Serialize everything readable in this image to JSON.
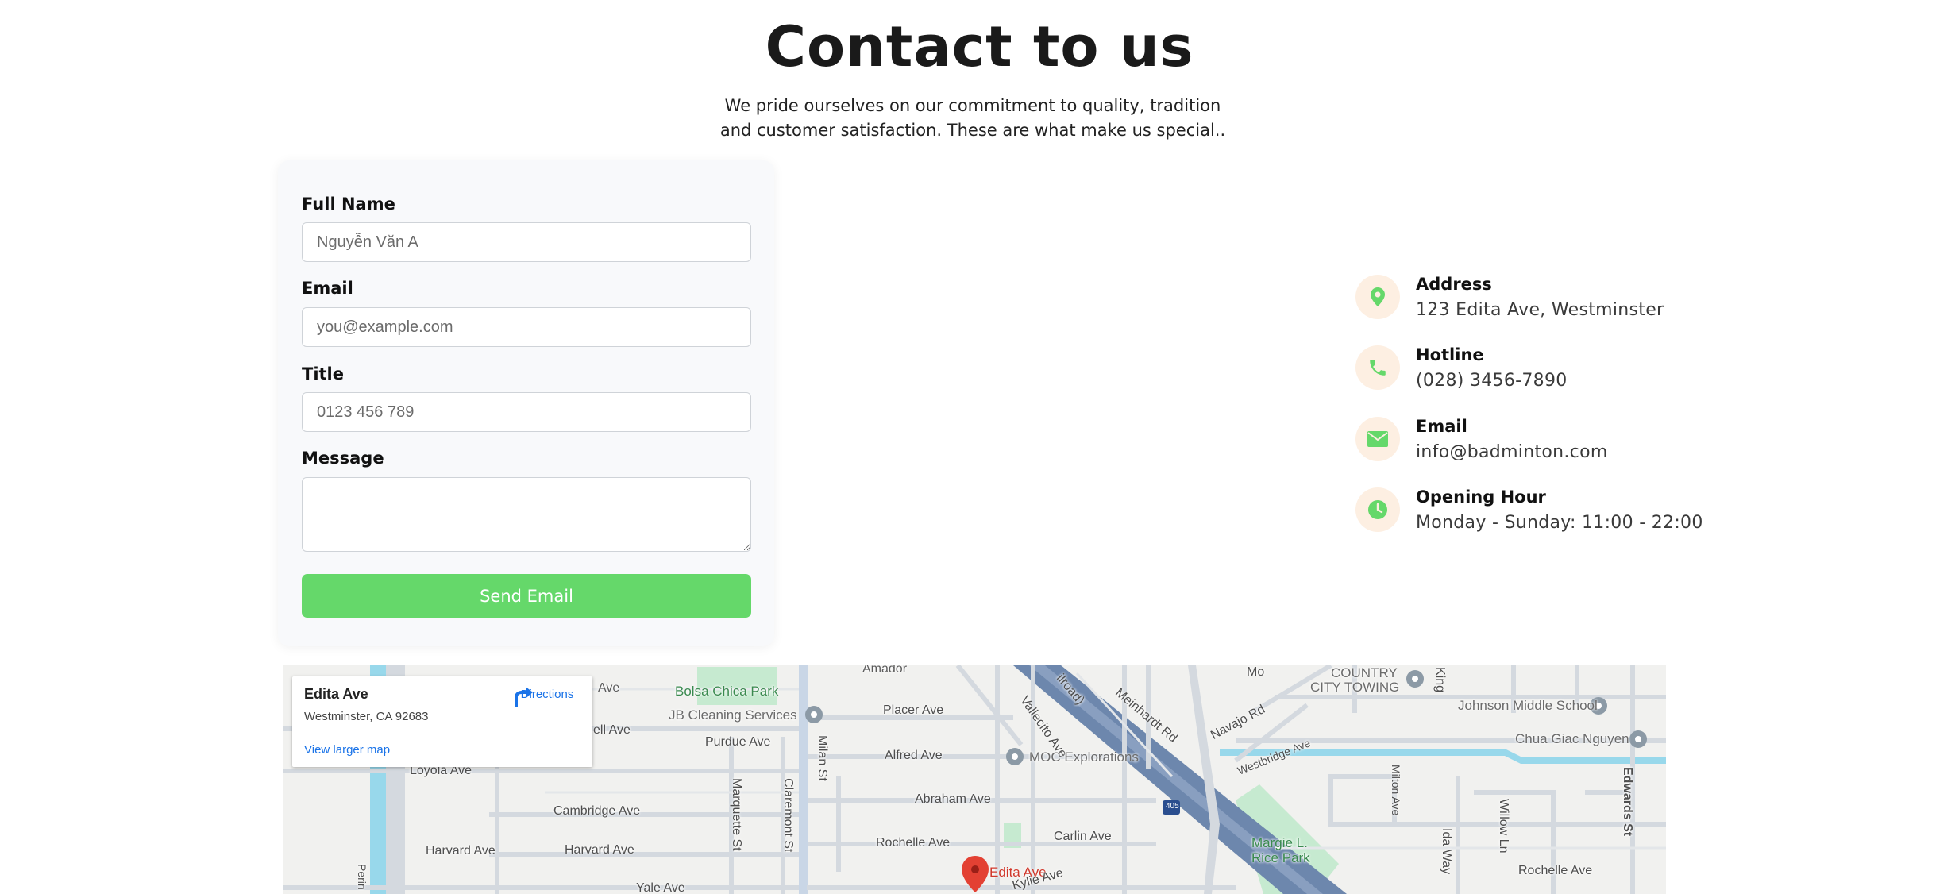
{
  "header": {
    "title": "Contact to us",
    "subtitle": "We pride ourselves on our commitment to quality, tradition and customer satisfaction. These are what make us special.."
  },
  "form": {
    "full_name_label": "Full Name",
    "full_name_placeholder": "Nguyễn Văn A",
    "email_label": "Email",
    "email_placeholder": "you@example.com",
    "title_label": "Title",
    "title_placeholder": "0123 456 789",
    "message_label": "Message",
    "message_value": "",
    "submit_label": "Send Email"
  },
  "contact_info": {
    "address": {
      "title": "Address",
      "value": "123 Edita Ave, Westminster",
      "icon": "map-pin-icon"
    },
    "hotline": {
      "title": "Hotline",
      "value": "(028) 3456-7890",
      "icon": "phone-icon"
    },
    "email": {
      "title": "Email",
      "value": "info@badminton.com",
      "icon": "envelope-icon"
    },
    "hours": {
      "title": "Opening Hour",
      "value": "Monday - Sunday: 11:00 - 22:00",
      "icon": "clock-icon"
    }
  },
  "colors": {
    "accent_green": "#65d86a",
    "icon_bg": "#fdefe2",
    "link_blue": "#1a73e8"
  },
  "map": {
    "place_name": "Edita Ave",
    "place_address": "Westminster, CA 92683",
    "directions_label": "Directions",
    "larger_map_link": "View larger map",
    "labels": {
      "amador": "Amador",
      "ave_top": "Ave",
      "bolsa_chica_park": "Bolsa Chica Park",
      "jb_cleaning": "JB Cleaning Services",
      "placer_ave": "Placer Ave",
      "vallecito_ave": "Vallecito Ave",
      "meinhardt_rd": "Meinhardt Rd",
      "navajo_rd": "Navajo Rd",
      "country_city_towing_1": "COUNTRY",
      "country_city_towing_2": "CITY TOWING",
      "king": "King",
      "johnson_middle_school": "Johnson Middle School",
      "chua_giac_nguyen": "Chua Giac Nguyen",
      "ell_ave": "ell Ave",
      "purdue_ave": "Purdue Ave",
      "alfred_ave": "Alfred Ave",
      "moc_explorations": "MOC Explorations",
      "westbridge_ave": "Westbridge Ave",
      "loyola_ave": "Loyola Ave",
      "cambridge_ave": "Cambridge Ave",
      "abraham_ave": "Abraham Ave",
      "margie_rice_park_1": "Margie L.",
      "margie_rice_park_2": "Rice Park",
      "harvard_ave_1": "Harvard Ave",
      "harvard_ave_2": "Harvard Ave",
      "rochelle_ave_1": "Rochelle Ave",
      "carlin_ave": "Carlin Ave",
      "edita_ave_pin": "Edita Ave",
      "kylie_ave": "Kylie Ave",
      "yale_ave": "Yale Ave",
      "rochelle_ave_2": "Rochelle Ave",
      "milan_st": "Milan St",
      "marquette_st": "Marquette St",
      "claremont_st": "Claremont St",
      "milton_ave": "Milton Ave",
      "ida_way": "Ida Way",
      "willow_ln": "Willow Ln",
      "edwards_st": "Edwards St",
      "perin": "Perin",
      "railroad": "ilroad)",
      "mo": "Mo",
      "highway_405": "405"
    }
  }
}
